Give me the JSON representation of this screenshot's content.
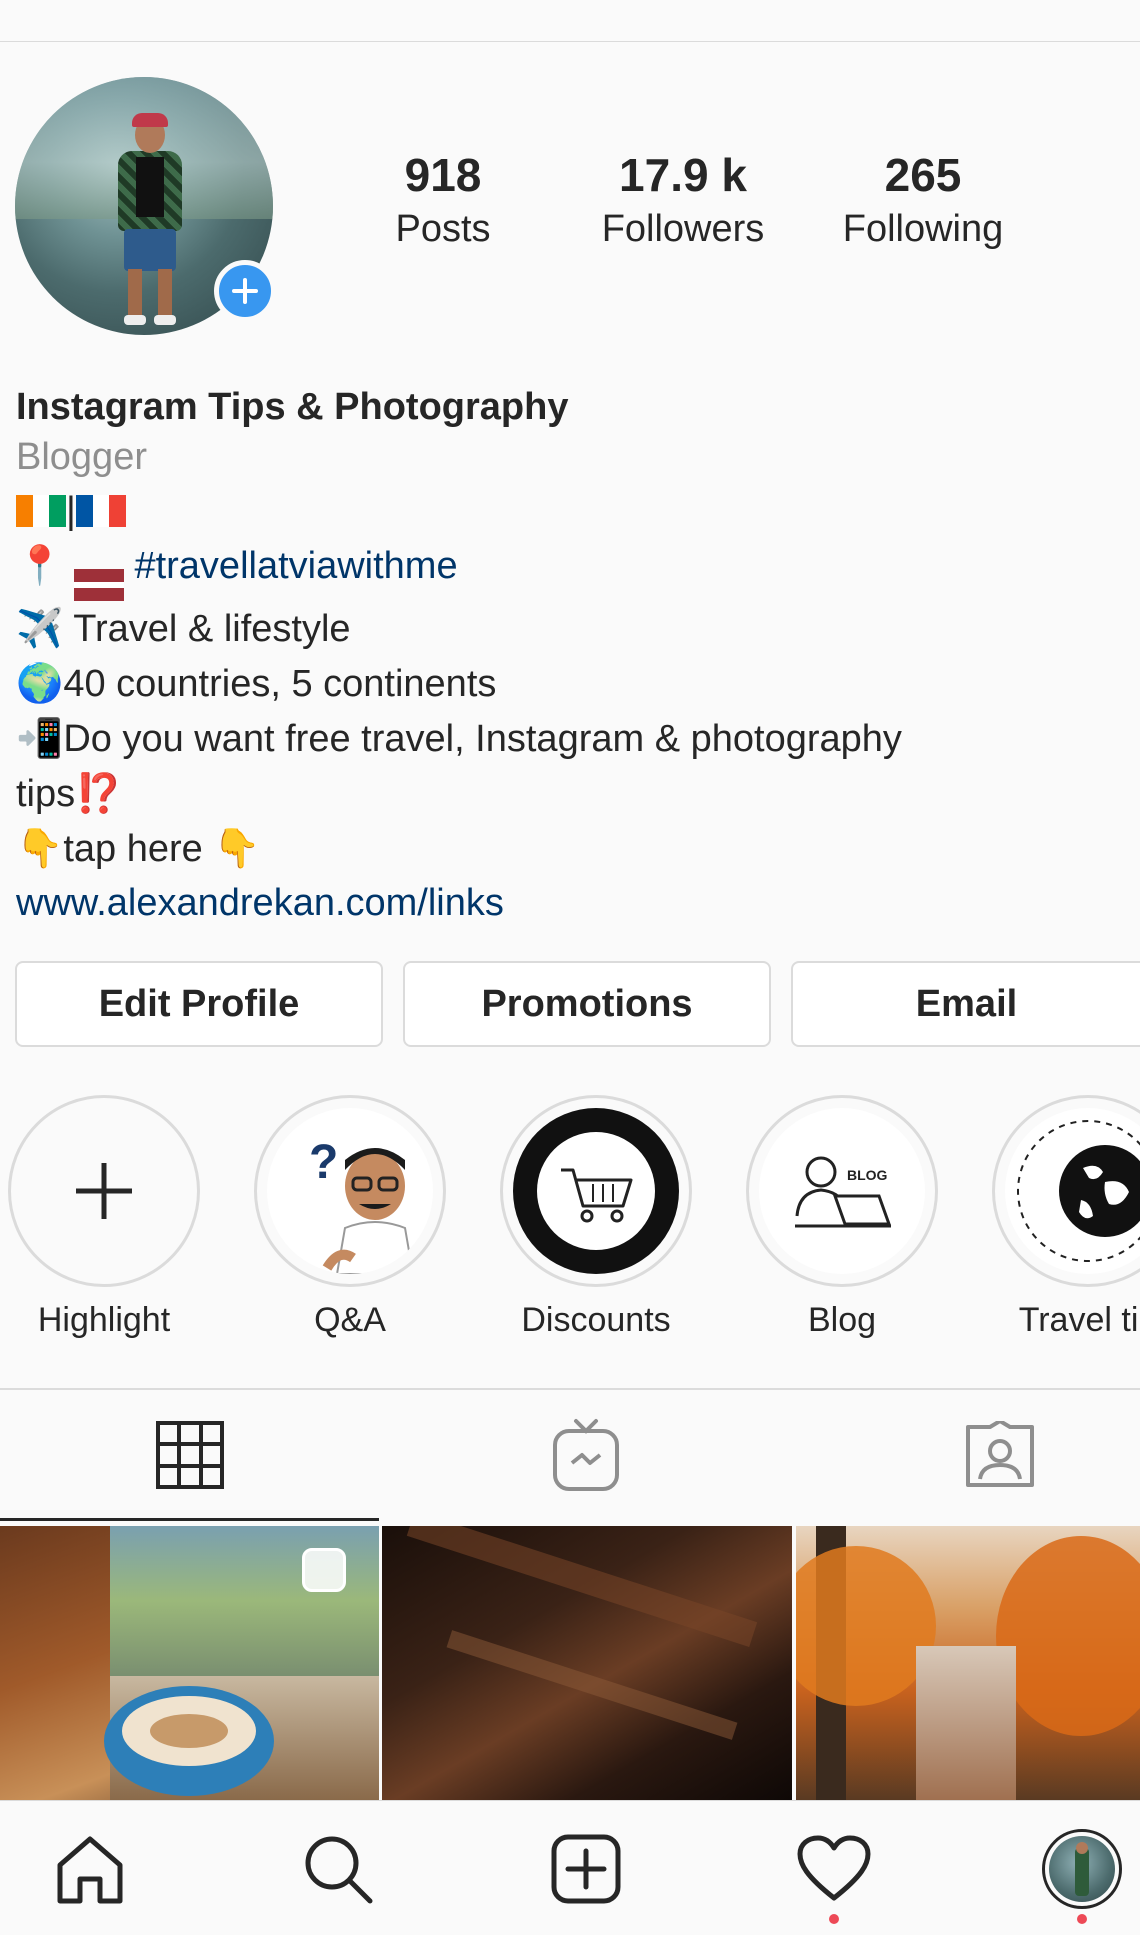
{
  "profile": {
    "stats": [
      {
        "value": "918",
        "label": "Posts"
      },
      {
        "value": "17.9 k",
        "label": "Followers"
      },
      {
        "value": "265",
        "label": "Following"
      }
    ],
    "name": "Instagram Tips & Photography",
    "category": "Blogger",
    "bio": {
      "line_flags_sep": "|",
      "hashtag": "#travellatviawithme",
      "travel": "Travel & lifestyle",
      "countries": "40 countries, 5 continents",
      "question": "Do you want free travel, Instagram & photography",
      "question_cont": "tips",
      "tap": "tap here",
      "link": "www.alexandrekan.com/links"
    },
    "emoji": {
      "pin": "📍",
      "plane": "✈️",
      "globe": "🌍",
      "phone": "📲",
      "interrobang": "⁉️",
      "point_down": "👇"
    }
  },
  "buttons": {
    "edit": "Edit Profile",
    "promotions": "Promotions",
    "email": "Email"
  },
  "highlights": [
    {
      "label": "Highlight"
    },
    {
      "label": "Q&A"
    },
    {
      "label": "Discounts"
    },
    {
      "label": "Blog"
    },
    {
      "label": "Travel tip"
    }
  ],
  "icons": {
    "add_story": "plus-icon",
    "tab_grid": "grid-icon",
    "tab_igtv": "igtv-icon",
    "tab_tagged": "tagged-icon",
    "nav": [
      "home-icon",
      "search-icon",
      "new-post-icon",
      "activity-heart-icon",
      "profile-avatar-icon"
    ]
  },
  "colors": {
    "accent_blue": "#3897f0",
    "link": "#003569",
    "notification": "#ed4956",
    "secondary_text": "#8e8e8e",
    "flag_ci": [
      "#f77f00",
      "#ffffff",
      "#009e60"
    ],
    "flag_fr": [
      "#0055a4",
      "#ffffff",
      "#ef4135"
    ],
    "flag_lv": [
      "#9e3039",
      "#ffffff",
      "#9e3039"
    ]
  }
}
